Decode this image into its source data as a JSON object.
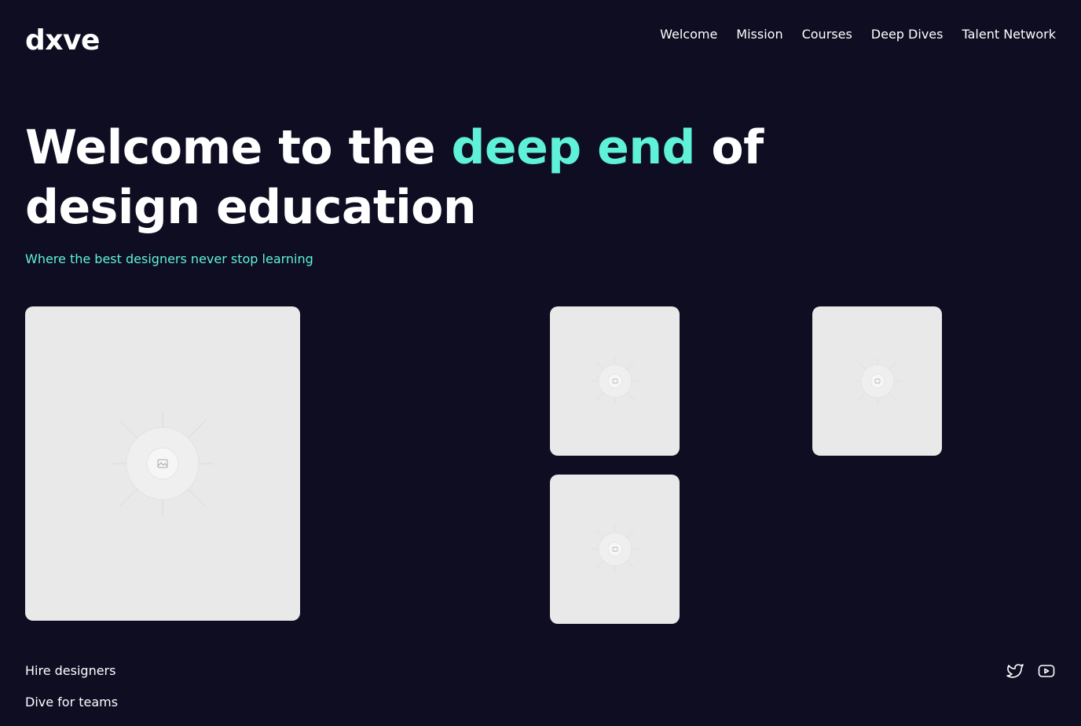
{
  "header": {
    "logo": "dxve",
    "nav": [
      "Welcome",
      "Mission",
      "Courses",
      "Deep Dives",
      "Talent Network"
    ]
  },
  "hero": {
    "title_before": "Welcome to the ",
    "title_accent": "deep end",
    "title_after": " of design education",
    "subtitle": "Where the best designers never stop learning"
  },
  "gallery": {
    "placeholder_icon": "image-placeholder-icon"
  },
  "footer": {
    "links": [
      "Hire designers",
      "Dive for teams"
    ],
    "social_icons": [
      "twitter-icon",
      "youtube-icon"
    ]
  },
  "colors": {
    "background": "#0e0d22",
    "accent": "#5ff2d9",
    "card": "#e9e9e9"
  }
}
